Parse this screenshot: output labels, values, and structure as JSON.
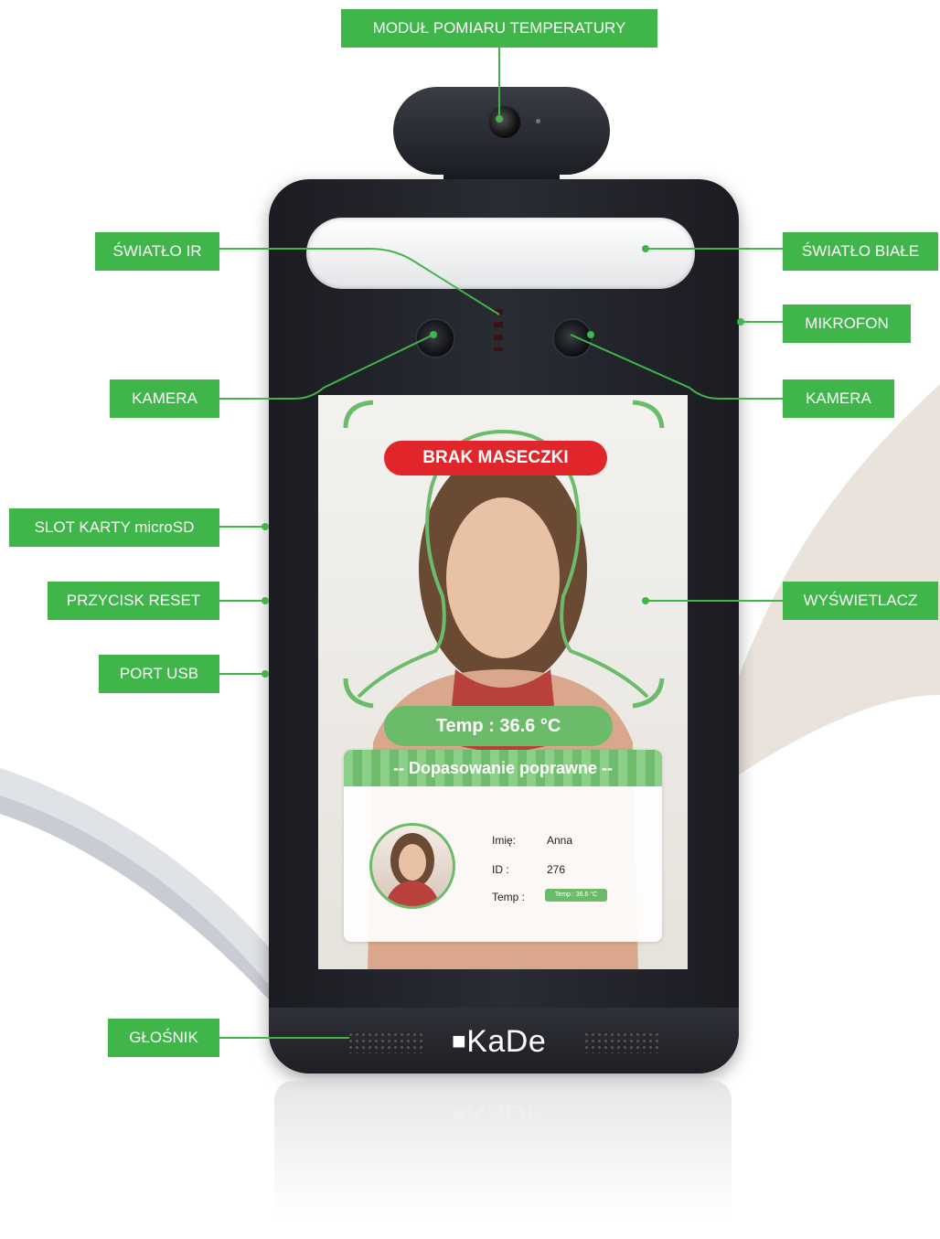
{
  "callouts": {
    "temperature_module": "MODUŁ POMIARU TEMPERATURY",
    "ir_light": "ŚWIATŁO IR",
    "white_light": "ŚWIATŁO BIAŁE",
    "microphone": "MIKROFON",
    "camera_left": "KAMERA",
    "camera_right": "KAMERA",
    "microsd_slot": "SLOT KARTY microSD",
    "reset_button": "PRZYCISK RESET",
    "usb_port": "PORT USB",
    "display": "WYŚWIETLACZ",
    "speaker": "GŁOŚNIK"
  },
  "screen": {
    "mask_alert": "BRAK MASECZKI",
    "temperature": "Temp : 36.6 °C",
    "match_status": "-- Dopasowanie poprawne --",
    "name_label": "Imię:",
    "name_value": "Anna",
    "id_label": "ID :",
    "id_value": "276",
    "temp_label": "Temp :",
    "temp_value": "Temp : 36.6 °C"
  },
  "brand": {
    "logo_text": "KaDe"
  },
  "colors": {
    "callout_green": "#3fb54a",
    "alert_red": "#e0262b",
    "device_body": "#1e1f24"
  }
}
